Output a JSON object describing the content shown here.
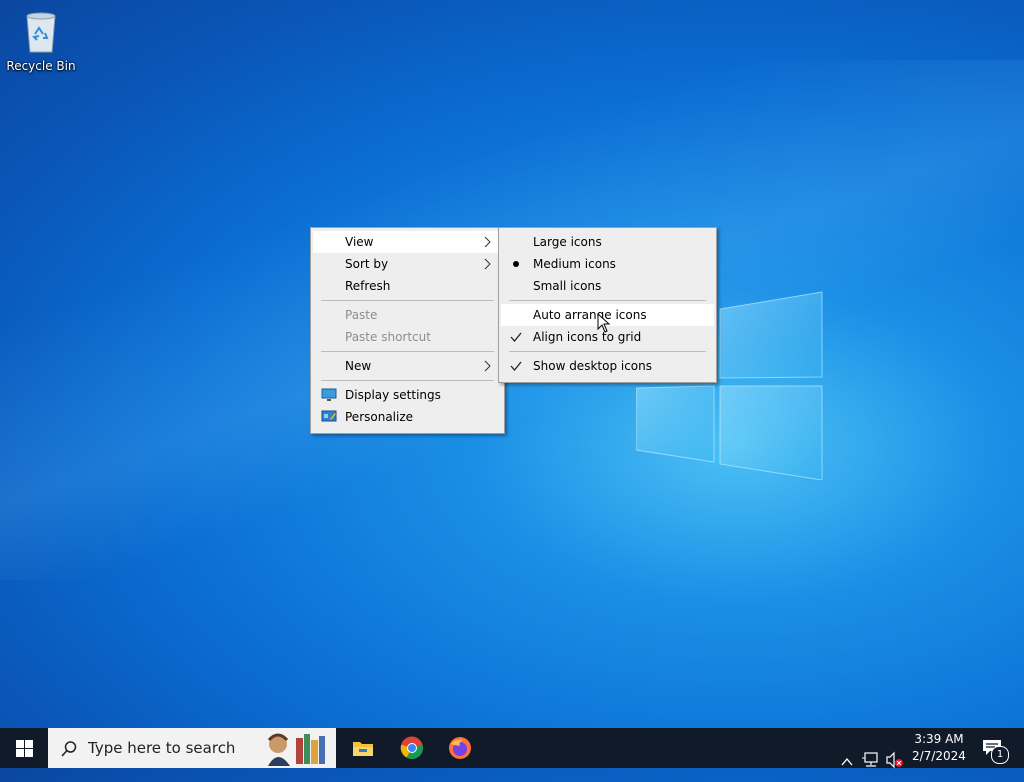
{
  "desktop": {
    "recycle_bin_label": "Recycle Bin"
  },
  "context_menu": {
    "items": [
      {
        "label": "View",
        "has_submenu": true,
        "highlighted": true
      },
      {
        "label": "Sort by",
        "has_submenu": true
      },
      {
        "label": "Refresh"
      },
      {
        "label": "Paste",
        "disabled": true
      },
      {
        "label": "Paste shortcut",
        "disabled": true
      },
      {
        "label": "New",
        "has_submenu": true
      },
      {
        "label": "Display settings",
        "icon": "display-settings-icon"
      },
      {
        "label": "Personalize",
        "icon": "personalize-icon"
      }
    ]
  },
  "view_submenu": {
    "items": [
      {
        "label": "Large icons"
      },
      {
        "label": "Medium icons",
        "mark": "bullet"
      },
      {
        "label": "Small icons"
      },
      {
        "label": "Auto arrange icons",
        "highlighted": true
      },
      {
        "label": "Align icons to grid",
        "mark": "check"
      },
      {
        "label": "Show desktop icons",
        "mark": "check"
      }
    ]
  },
  "taskbar": {
    "search_placeholder": "Type here to search",
    "apps": [
      "file-explorer-icon",
      "chrome-icon",
      "firefox-icon"
    ],
    "clock_time": "3:39 AM",
    "clock_date": "2/7/2024",
    "notification_count": "1"
  },
  "colors": {
    "taskbar": "#101a28",
    "menu_bg": "#eeeeee",
    "menu_highlight": "#ffffff",
    "disabled_text": "#8e8e8e"
  }
}
